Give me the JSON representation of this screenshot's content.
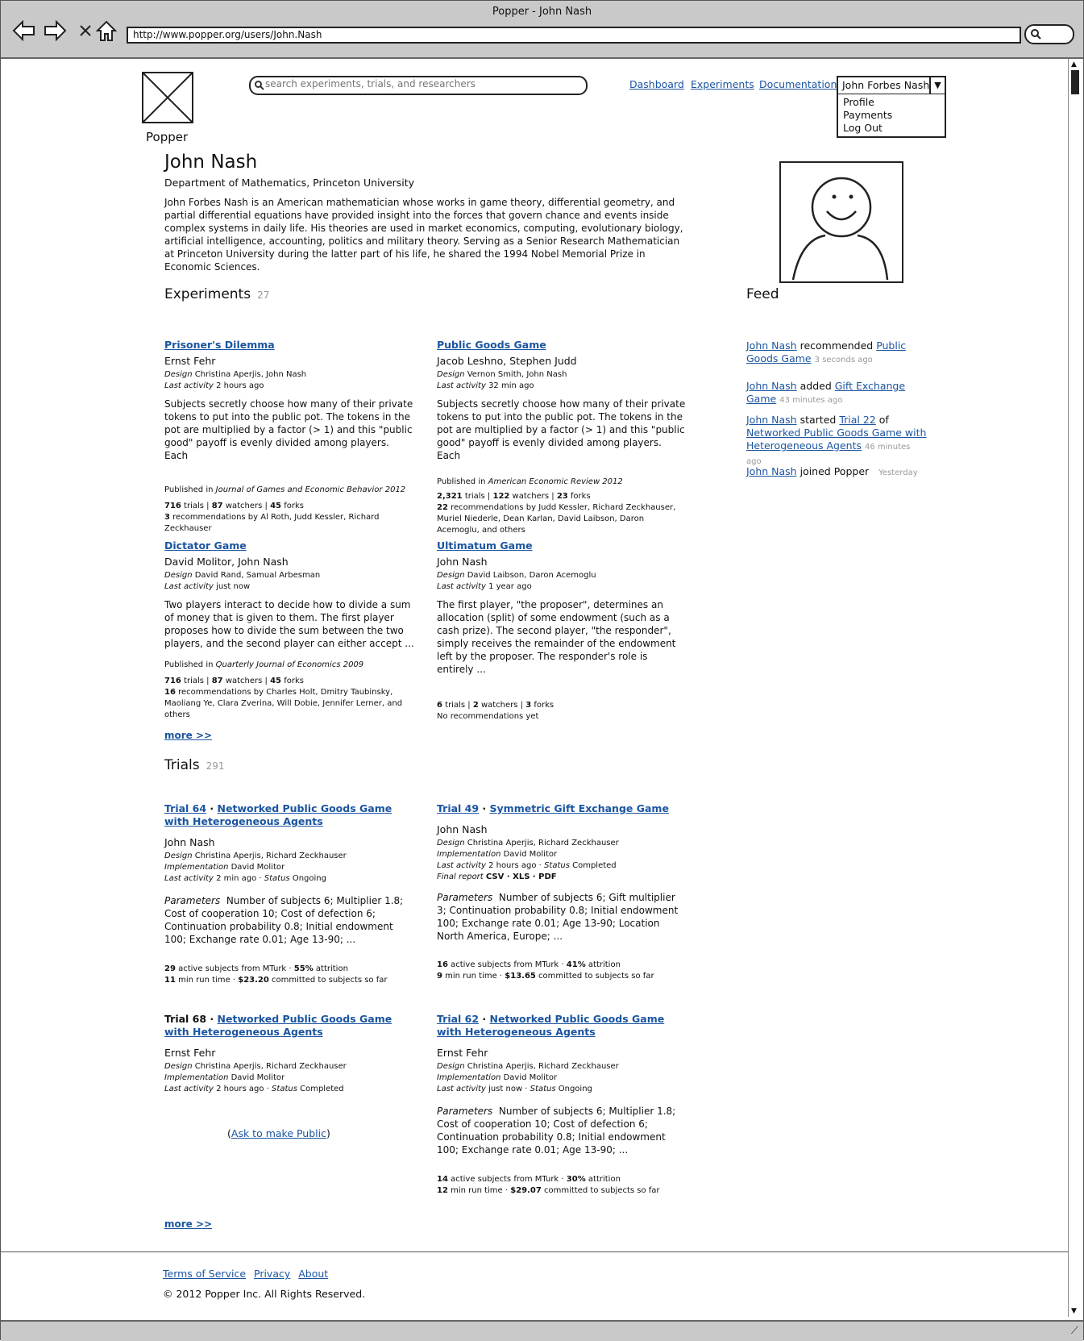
{
  "window": {
    "title": "Popper - John Nash",
    "url": "http://www.popper.org/users/John.Nash"
  },
  "header": {
    "logo_text": "Popper",
    "search_placeholder": "search experiments, trials, and researchers",
    "nav": [
      "Dashboard",
      "Experiments",
      "Documentation"
    ],
    "user_menu": {
      "label": "John Forbes Nash",
      "items": [
        "Profile",
        "Payments",
        "Log Out"
      ]
    }
  },
  "profile": {
    "name": "John Nash",
    "department": "Department of Mathematics, Princeton University",
    "bio": "John Forbes Nash is an American mathematician whose works in game theory, differential geometry, and partial differential equations have provided insight into the forces that govern chance and events inside complex systems in daily life. His theories are used in market economics, computing, evolutionary biology, artificial intelligence, accounting, politics and military theory. Serving as a Senior Research Mathematician at Princeton University during the latter part of his life, he shared the 1994 Nobel Memorial Prize in Economic Sciences."
  },
  "experiments": {
    "title": "Experiments",
    "count": "27",
    "more": "more >>",
    "items": [
      {
        "title": "Prisoner's Dilemma",
        "authors": "Ernst Fehr",
        "design": "Christina Aperjis, John Nash",
        "last_activity": "2 hours ago",
        "description": "Subjects secretly choose how many of their private tokens to put into the public pot. The tokens in the pot are multiplied by a factor (> 1) and this \"public good\" payoff is evenly divided among players. Each",
        "published_prefix": "Published in",
        "published_in": "Journal of Games and Economic Behavior 2012",
        "trials": "716",
        "watchers": "87",
        "forks": "45",
        "recommendations_count": "3",
        "recommendations_text": "recommendations by Al Roth, Judd Kessler, Richard Zeckhauser"
      },
      {
        "title": "Public Goods Game",
        "authors": "Jacob Leshno, Stephen Judd",
        "design": "Vernon Smith, John Nash",
        "last_activity": "32 min ago",
        "description": "Subjects secretly choose how many of their private tokens to put into the public pot. The tokens in the pot are multiplied by a factor (> 1) and this \"public good\" payoff is evenly divided among players. Each",
        "published_prefix": "Published in",
        "published_in": "American Economic Review 2012",
        "trials": "2,321",
        "watchers": "122",
        "forks": "23",
        "recommendations_count": "22",
        "recommendations_text": "recommendations by Judd Kessler, Richard Zeckhauser, Muriel Niederle, Dean Karlan, David Laibson, Daron Acemoglu, and others"
      },
      {
        "title": "Dictator Game",
        "authors": "David Molitor, John Nash",
        "design": "David Rand, Samual Arbesman",
        "last_activity": "just now",
        "description": "Two players interact to decide how to divide a sum of money that is given to them. The first player proposes how to divide the sum between the two players, and the second player can either accept ...",
        "published_prefix": "Published in",
        "published_in": "Quarterly Journal of Economics 2009",
        "trials": "716",
        "watchers": "87",
        "forks": "45",
        "recommendations_count": "16",
        "recommendations_text": "recommendations by Charles Holt, Dmitry Taubinsky, Maoliang Ye, Clara Zverina, Will Dobie, Jennifer Lerner, and others"
      },
      {
        "title": "Ultimatum Game",
        "authors": "John Nash",
        "design": "David Laibson, Daron Acemoglu",
        "last_activity": "1 year ago",
        "description": "The first player, \"the proposer\", determines an allocation (split) of some endowment (such as a cash prize). The second player, \"the responder\", simply receives the remainder of the endowment left by the proposer. The responder's role is entirely ...",
        "trials": "6",
        "watchers": "2",
        "forks": "3",
        "recommendations_note": "No recommendations yet"
      }
    ]
  },
  "feed": {
    "title": "Feed",
    "items": [
      {
        "actor": "John Nash",
        "action": "recommended",
        "target": "Public Goods Game",
        "time": "3 seconds ago"
      },
      {
        "actor": "John Nash",
        "action": "added",
        "target": "Gift Exchange Game",
        "time": "43 minutes ago"
      },
      {
        "actor": "John Nash",
        "action": "started",
        "target": "Trial 22",
        "joiner": "of",
        "target2": "Networked Public Goods Game with Heterogeneous Agents",
        "time": "46 minutes ago"
      },
      {
        "actor": "John Nash",
        "action": "joined Popper",
        "time": "Yesterday"
      }
    ]
  },
  "trials": {
    "title": "Trials",
    "count": "291",
    "more": "more >>",
    "labels": {
      "design": "Design",
      "implementation": "Implementation",
      "last_activity": "Last activity",
      "status": "Status",
      "parameters": "Parameters",
      "final_report": "Final report"
    },
    "items": [
      {
        "trial": "Trial 64",
        "experiment": "Networked Public Goods Game with Heterogeneous Agents",
        "authors": "John Nash",
        "design": "Christina Aperjis, Richard Zeckhauser",
        "implementation": "David Molitor",
        "last_activity": "2 min ago",
        "status": "Ongoing",
        "parameters": "Number of subjects 6; Multiplier 1.8; Cost of cooperation 10; Cost of defection 6; Continuation probability 0.8; Initial endowment 100; Exchange rate 0.01; Age 13-90; ...",
        "active_subjects": "29",
        "subjects_text": "active subjects from MTurk",
        "attrition": "55%",
        "run_time": "11",
        "committed": "$23.20"
      },
      {
        "trial": "Trial 49",
        "experiment": "Symmetric Gift Exchange Game",
        "authors": "John Nash",
        "design": "Christina Aperjis, Richard Zeckhauser",
        "implementation": "David Molitor",
        "last_activity": "2 hours ago",
        "status": "Completed",
        "final_report": "CSV · XLS · PDF",
        "parameters": "Number of subjects 6; Gift multiplier 3; Continuation probability 0.8; Initial endowment 100; Exchange rate 0.01; Age 13-90; Location North America, Europe; ...",
        "active_subjects": "16",
        "subjects_text": "active subjects from MTurk",
        "attrition": "41%",
        "run_time": "9",
        "committed": "$13.65"
      },
      {
        "trial": "Trial 68",
        "experiment": "Networked Public Goods Game with Heterogeneous Agents",
        "authors": "Ernst Fehr",
        "design": "Christina Aperjis, Richard Zeckhauser",
        "implementation": "David Molitor",
        "last_activity": "2 hours ago",
        "status": "Completed",
        "ask_public": "Ask to make Public"
      },
      {
        "trial": "Trial 62",
        "experiment": "Networked Public Goods Game with Heterogeneous Agents",
        "authors": "Ernst Fehr",
        "design": "Christina Aperjis, Richard Zeckhauser",
        "implementation": "David Molitor",
        "last_activity": "just now",
        "status": "Ongoing",
        "parameters": "Number of subjects 6; Multiplier 1.8; Cost of cooperation 10; Cost of defection 6; Continuation probability 0.8; Initial endowment 100; Exchange rate 0.01; Age 13-90; ...",
        "active_subjects": "14",
        "subjects_text": "active subjects from MTurk",
        "attrition": "30%",
        "run_time": "12",
        "committed": "$29.07"
      }
    ]
  },
  "footer": {
    "links": [
      "Terms of Service",
      "Privacy",
      "About"
    ],
    "copyright": "© 2012 Popper Inc. All Rights Reserved."
  }
}
